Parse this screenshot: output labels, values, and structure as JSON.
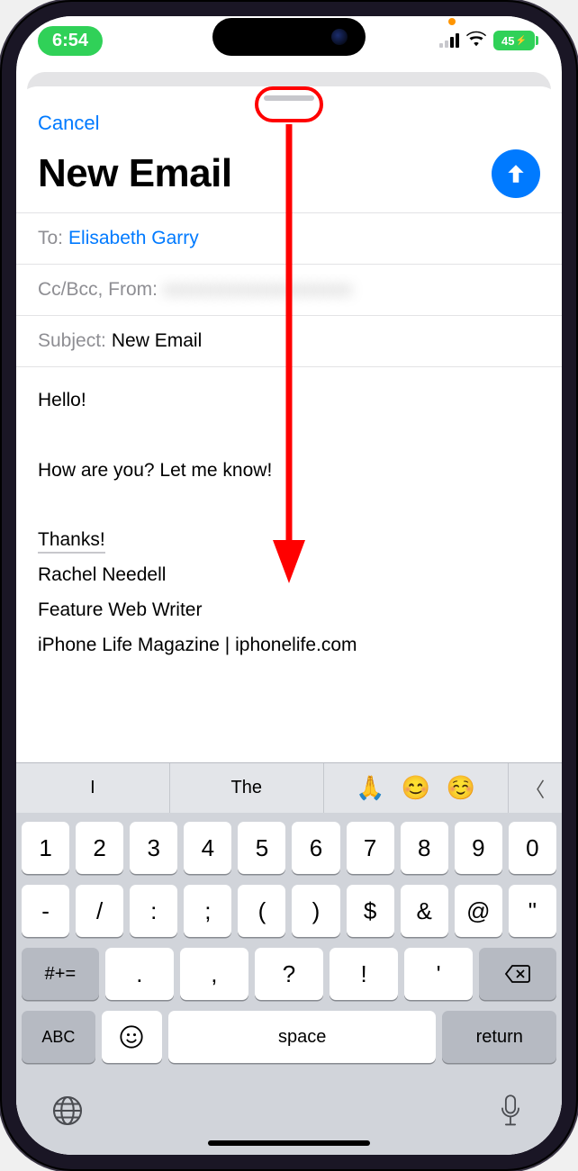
{
  "status": {
    "time": "6:54",
    "battery": "45"
  },
  "sheet": {
    "cancel": "Cancel",
    "title": "New Email"
  },
  "fields": {
    "to_label": "To:",
    "to_value": "Elisabeth Garry",
    "ccbcc_label": "Cc/Bcc, From:",
    "ccbcc_value": "xxxxxxxxxxxxxxxxxxxx",
    "subject_label": "Subject:",
    "subject_value": "New Email"
  },
  "body": {
    "line1": "Hello!",
    "line2": "How are you? Let me know!",
    "line3": "Thanks!",
    "line4": "Rachel Needell",
    "line5": "Feature Web Writer",
    "line6": "iPhone Life Magazine | iphonelife.com"
  },
  "suggestions": {
    "s1": "I",
    "s2": "The",
    "e1": "🙏",
    "e2": "😊",
    "e3": "☺️",
    "chev": "〈"
  },
  "kb": {
    "row1": [
      "1",
      "2",
      "3",
      "4",
      "5",
      "6",
      "7",
      "8",
      "9",
      "0"
    ],
    "row2": [
      "-",
      "/",
      ":",
      ";",
      "(",
      ")",
      "$",
      "&",
      "@",
      "\""
    ],
    "row3_sym": "#+=",
    "row3": [
      ".",
      ",",
      "?",
      "!",
      "'"
    ],
    "abc": "ABC",
    "space": "space",
    "return": "return"
  }
}
